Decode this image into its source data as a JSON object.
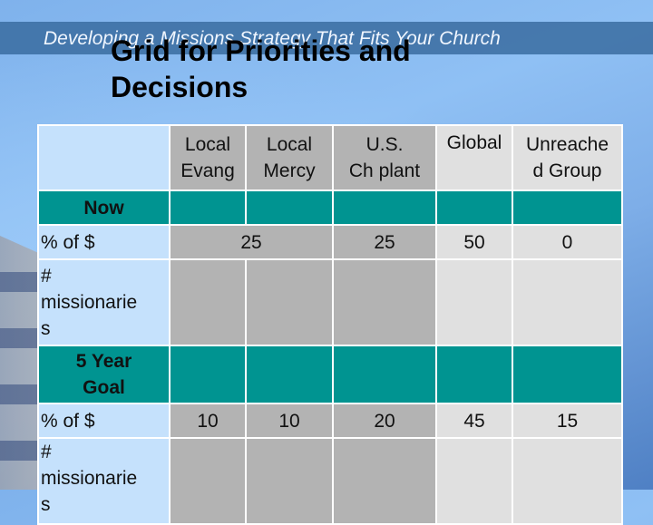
{
  "slide": {
    "subtitle": "Developing a Missions Strategy That Fits Your Church",
    "title_line1": "Grid for Priorities and",
    "title_line2": "Decisions"
  },
  "colors": {
    "section_teal": "#009491",
    "cell_dark": "#b3b3b3",
    "cell_light": "#e0e0e0",
    "banner": "#3a6ca0"
  },
  "table": {
    "columns": [
      "",
      "Local Evang",
      "Local Mercy",
      "U.S. Ch plant",
      "Global",
      "Unreache d Group"
    ],
    "col_lines": [
      [
        "Local",
        "Evang"
      ],
      [
        "Local",
        "Mercy"
      ],
      [
        "U.S.",
        "Ch plant"
      ],
      [
        "Global",
        ""
      ],
      [
        "Unreache",
        "d Group"
      ]
    ],
    "sections": [
      {
        "label": "Now",
        "rows": [
          {
            "label": "% of $",
            "values": {
              "local_combined": "25",
              "us_ch_plant": "25",
              "global": "50",
              "unreached": "0"
            }
          },
          {
            "label": "# missionaries",
            "label_lines": [
              "#",
              "missionarie",
              "s"
            ],
            "values": {
              "local_evang": "",
              "local_mercy": "",
              "us_ch_plant": "",
              "global": "",
              "unreached": ""
            }
          }
        ]
      },
      {
        "label": "5 Year Goal",
        "label_lines": [
          "5 Year",
          "Goal"
        ],
        "rows": [
          {
            "label": "% of $",
            "values": {
              "local_evang": "10",
              "local_mercy": "10",
              "us_ch_plant": "20",
              "global": "45",
              "unreached": "15"
            }
          },
          {
            "label": "# missionaries",
            "label_lines": [
              "#",
              "missionarie",
              "s"
            ],
            "values": {
              "local_evang": "",
              "local_mercy": "",
              "us_ch_plant": "",
              "global": "",
              "unreached": ""
            }
          }
        ]
      }
    ]
  }
}
